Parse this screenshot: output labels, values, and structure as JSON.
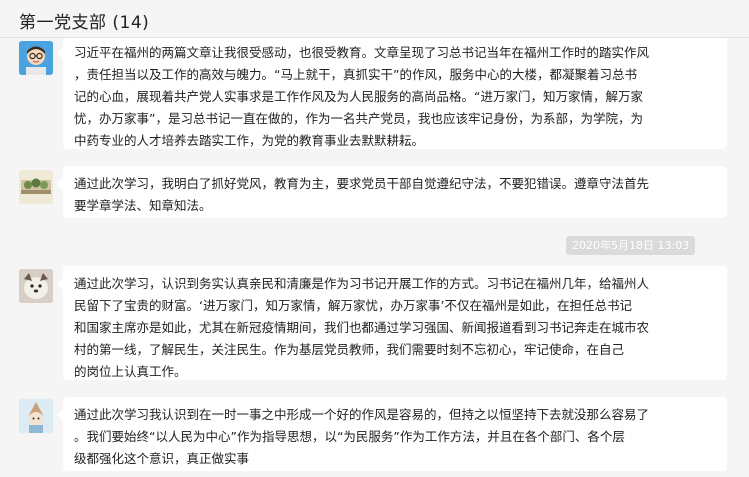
{
  "header": {
    "title": "第一党支部 (14)"
  },
  "messages": [
    {
      "avatar_icon": "person-glasses-avatar",
      "text": "习近平在福州的两篇文章让我很受感动，也很受教育。文章呈现了习总书记当年在福州工作时的踏实作风\n，责任担当以及工作的高效与魄力。“马上就干，真抓实干”的作风，服务中心的大楼，都凝聚着习总书\n记的心血，展现着共产党人实事求是工作作风及为人民服务的高尚品格。“进万家门，知万家情，解万家\n忧，办万家事”，是习总书记一直在做的，作为一名共产党员，我也应该牢记身份，为系部，为学院，为\n中药专业的人才培养去踏实工作，为党的教育事业去默默耕耘。"
    },
    {
      "avatar_icon": "landscape-avatar",
      "text": "通过此次学习，我明白了抓好党风，教育为主，要求党员干部自觉遵纪守法，不要犯错误。遵章守法首先\n要学章学法、知章知法。"
    },
    {
      "avatar_icon": "dog-avatar",
      "text": "通过此次学习，认识到务实认真亲民和清廉是作为习书记开展工作的方式。习书记在福州几年，给福州人\n民留下了宝贵的财富。‘进万家门，知万家情，解万家忧，办万家事’不仅在福州是如此，在担任总书记\n和国家主席亦是如此，尤其在新冠疫情期间，我们也都通过学习强国、新闻报道看到习书记奔走在城市农\n村的第一线，了解民生，关注民生。作为基层党员教师，我们需要时刻不忘初心，牢记使命，在自己\n的岗位上认真工作。"
    },
    {
      "avatar_icon": "cartoon-avatar",
      "text": "通过此次学习我认识到在一时一事之中形成一个好的作风是容易的，但持之以恒坚持下去就没那么容易了\n。我们要始终“以人民为中心”作为指导思想，以“为民服务”作为工作方法，并且在各个部门、各个层\n级都强化这个意识，真正做实事"
    }
  ],
  "timestamp": "2020年5月18日 13:03",
  "colors": {
    "background": "#f5f5f5",
    "bubble": "#ffffff",
    "timestamp_bg": "#dadada"
  }
}
